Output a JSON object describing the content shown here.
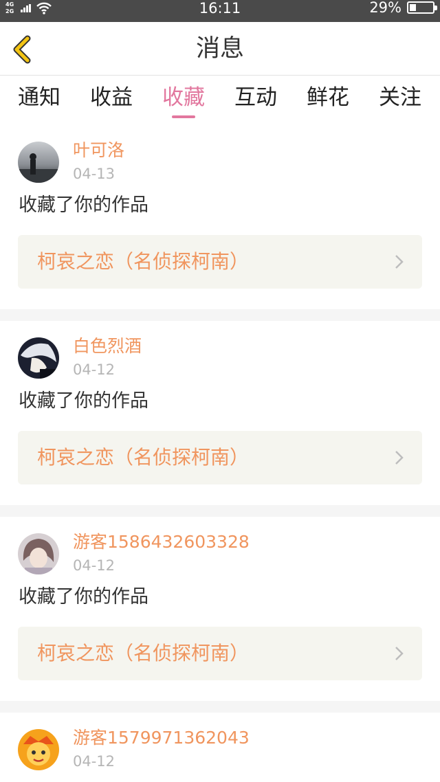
{
  "status_bar": {
    "network_top": "4G",
    "network_bottom": "2G",
    "time": "16:11",
    "battery_percent": "29%",
    "battery_level": 0.29
  },
  "header": {
    "title": "消息",
    "back_icon": "chevron-left-icon"
  },
  "tabs": {
    "items": [
      {
        "label": "通知"
      },
      {
        "label": "收益"
      },
      {
        "label": "收藏",
        "active": true
      },
      {
        "label": "互动"
      },
      {
        "label": "鲜花"
      },
      {
        "label": "关注"
      }
    ],
    "active_color": "#e2779e"
  },
  "messages": [
    {
      "username": "叶可洛",
      "date": "04-13",
      "action": "收藏了你的作品",
      "work": "柯哀之恋（名侦探柯南）"
    },
    {
      "username": "白色烈酒",
      "date": "04-12",
      "action": "收藏了你的作品",
      "work": "柯哀之恋（名侦探柯南）"
    },
    {
      "username": "游客1586432603328",
      "date": "04-12",
      "action": "收藏了你的作品",
      "work": "柯哀之恋（名侦探柯南）"
    },
    {
      "username": "游客1579971362043",
      "date": "04-12",
      "action": "",
      "work": ""
    }
  ],
  "colors": {
    "accent_orange": "#f0955e",
    "header_back": "#f3c413"
  }
}
